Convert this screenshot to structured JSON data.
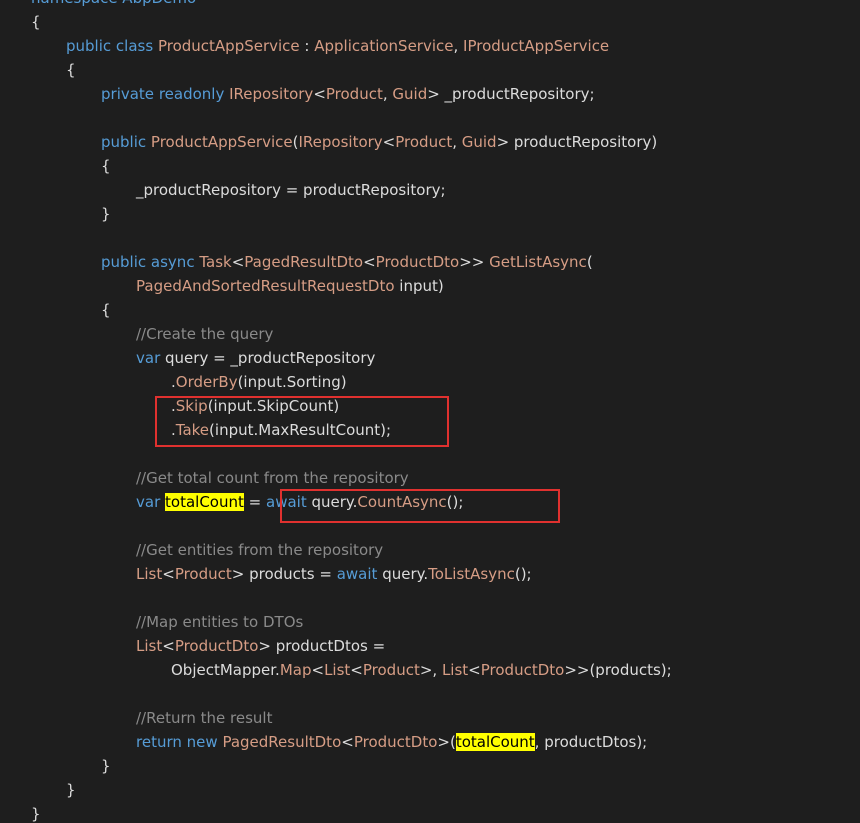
{
  "colors": {
    "background": "#1e1e1e",
    "keyword": "#569cd6",
    "type": "#d69d85",
    "identifier": "#dcdcdc",
    "method": "#d69d85",
    "comment": "#8a8a8a",
    "punctuation": "#dcdcdc",
    "highlight_bg": "#ffff00",
    "highlight_fg": "#000000",
    "annotation_box": "#e0312f"
  },
  "code_lines": [
    {
      "indent": 0,
      "tokens": [
        {
          "t": "namespace AbpDemo",
          "c": "keyword"
        }
      ]
    },
    {
      "indent": 0,
      "tokens": [
        {
          "t": "{",
          "c": "punct"
        }
      ]
    },
    {
      "indent": 1,
      "tokens": [
        {
          "t": "public",
          "c": "keyword"
        },
        {
          "t": " "
        },
        {
          "t": "class",
          "c": "keyword"
        },
        {
          "t": " "
        },
        {
          "t": "ProductAppService",
          "c": "type"
        },
        {
          "t": " : "
        },
        {
          "t": "ApplicationService",
          "c": "type"
        },
        {
          "t": ", "
        },
        {
          "t": "IProductAppService",
          "c": "type"
        }
      ]
    },
    {
      "indent": 1,
      "tokens": [
        {
          "t": "{",
          "c": "punct"
        }
      ]
    },
    {
      "indent": 2,
      "tokens": [
        {
          "t": "private",
          "c": "keyword"
        },
        {
          "t": " "
        },
        {
          "t": "readonly",
          "c": "keyword"
        },
        {
          "t": " "
        },
        {
          "t": "IRepository",
          "c": "type"
        },
        {
          "t": "<"
        },
        {
          "t": "Product",
          "c": "type"
        },
        {
          "t": ", "
        },
        {
          "t": "Guid",
          "c": "type"
        },
        {
          "t": "> _productRepository;"
        }
      ]
    },
    {
      "indent": 0,
      "tokens": []
    },
    {
      "indent": 2,
      "tokens": [
        {
          "t": "public",
          "c": "keyword"
        },
        {
          "t": " "
        },
        {
          "t": "ProductAppService",
          "c": "type"
        },
        {
          "t": "("
        },
        {
          "t": "IRepository",
          "c": "type"
        },
        {
          "t": "<"
        },
        {
          "t": "Product",
          "c": "type"
        },
        {
          "t": ", "
        },
        {
          "t": "Guid",
          "c": "type"
        },
        {
          "t": "> productRepository)"
        }
      ]
    },
    {
      "indent": 2,
      "tokens": [
        {
          "t": "{",
          "c": "punct"
        }
      ]
    },
    {
      "indent": 3,
      "tokens": [
        {
          "t": "_productRepository = productRepository;"
        }
      ]
    },
    {
      "indent": 2,
      "tokens": [
        {
          "t": "}",
          "c": "punct"
        }
      ]
    },
    {
      "indent": 0,
      "tokens": []
    },
    {
      "indent": 2,
      "tokens": [
        {
          "t": "public",
          "c": "keyword"
        },
        {
          "t": " "
        },
        {
          "t": "async",
          "c": "keyword"
        },
        {
          "t": " "
        },
        {
          "t": "Task",
          "c": "type"
        },
        {
          "t": "<"
        },
        {
          "t": "PagedResultDto",
          "c": "type"
        },
        {
          "t": "<"
        },
        {
          "t": "ProductDto",
          "c": "type"
        },
        {
          "t": ">> "
        },
        {
          "t": "GetListAsync",
          "c": "method"
        },
        {
          "t": "("
        }
      ]
    },
    {
      "indent": 3,
      "tokens": [
        {
          "t": "PagedAndSortedResultRequestDto",
          "c": "type"
        },
        {
          "t": " input)"
        }
      ]
    },
    {
      "indent": 2,
      "tokens": [
        {
          "t": "{",
          "c": "punct"
        }
      ]
    },
    {
      "indent": 3,
      "tokens": [
        {
          "t": "//Create the query",
          "c": "comment"
        }
      ]
    },
    {
      "indent": 3,
      "tokens": [
        {
          "t": "var",
          "c": "keyword"
        },
        {
          "t": " query = _productRepository"
        }
      ]
    },
    {
      "indent": 4,
      "tokens": [
        {
          "t": "."
        },
        {
          "t": "OrderBy",
          "c": "method"
        },
        {
          "t": "(input.Sorting)"
        }
      ]
    },
    {
      "indent": 4,
      "tokens": [
        {
          "t": "."
        },
        {
          "t": "Skip",
          "c": "method"
        },
        {
          "t": "(input.SkipCount)"
        }
      ]
    },
    {
      "indent": 4,
      "tokens": [
        {
          "t": "."
        },
        {
          "t": "Take",
          "c": "method"
        },
        {
          "t": "(input.MaxResultCount);"
        }
      ]
    },
    {
      "indent": 0,
      "tokens": []
    },
    {
      "indent": 3,
      "tokens": [
        {
          "t": "//Get total count from the repository",
          "c": "comment"
        }
      ]
    },
    {
      "indent": 3,
      "tokens": [
        {
          "t": "var",
          "c": "keyword"
        },
        {
          "t": " "
        },
        {
          "t": "totalCount",
          "c": "hl"
        },
        {
          "t": " = "
        },
        {
          "t": "await",
          "c": "keyword"
        },
        {
          "t": " query."
        },
        {
          "t": "CountAsync",
          "c": "method"
        },
        {
          "t": "();"
        }
      ]
    },
    {
      "indent": 0,
      "tokens": []
    },
    {
      "indent": 3,
      "tokens": [
        {
          "t": "//Get entities from the repository",
          "c": "comment"
        }
      ]
    },
    {
      "indent": 3,
      "tokens": [
        {
          "t": "List",
          "c": "type"
        },
        {
          "t": "<"
        },
        {
          "t": "Product",
          "c": "type"
        },
        {
          "t": "> products = "
        },
        {
          "t": "await",
          "c": "keyword"
        },
        {
          "t": " query."
        },
        {
          "t": "ToListAsync",
          "c": "method"
        },
        {
          "t": "();"
        }
      ]
    },
    {
      "indent": 0,
      "tokens": []
    },
    {
      "indent": 3,
      "tokens": [
        {
          "t": "//Map entities to DTOs",
          "c": "comment"
        }
      ]
    },
    {
      "indent": 3,
      "tokens": [
        {
          "t": "List",
          "c": "type"
        },
        {
          "t": "<"
        },
        {
          "t": "ProductDto",
          "c": "type"
        },
        {
          "t": "> productDtos ="
        }
      ]
    },
    {
      "indent": 4,
      "tokens": [
        {
          "t": "ObjectMapper."
        },
        {
          "t": "Map",
          "c": "method"
        },
        {
          "t": "<"
        },
        {
          "t": "List",
          "c": "type"
        },
        {
          "t": "<"
        },
        {
          "t": "Product",
          "c": "type"
        },
        {
          "t": ">, "
        },
        {
          "t": "List",
          "c": "type"
        },
        {
          "t": "<"
        },
        {
          "t": "ProductDto",
          "c": "type"
        },
        {
          "t": ">>(products);"
        }
      ]
    },
    {
      "indent": 0,
      "tokens": []
    },
    {
      "indent": 3,
      "tokens": [
        {
          "t": "//Return the result",
          "c": "comment"
        }
      ]
    },
    {
      "indent": 3,
      "tokens": [
        {
          "t": "return",
          "c": "keyword"
        },
        {
          "t": " "
        },
        {
          "t": "new",
          "c": "keyword"
        },
        {
          "t": " "
        },
        {
          "t": "PagedResultDto",
          "c": "type"
        },
        {
          "t": "<"
        },
        {
          "t": "ProductDto",
          "c": "type"
        },
        {
          "t": ">("
        },
        {
          "t": "totalCount",
          "c": "hl"
        },
        {
          "t": ", productDtos);"
        }
      ]
    },
    {
      "indent": 2,
      "tokens": [
        {
          "t": "}",
          "c": "punct"
        }
      ]
    },
    {
      "indent": 1,
      "tokens": [
        {
          "t": "}",
          "c": "punct"
        }
      ]
    },
    {
      "indent": 0,
      "tokens": [
        {
          "t": "}",
          "c": "punct"
        }
      ]
    }
  ]
}
